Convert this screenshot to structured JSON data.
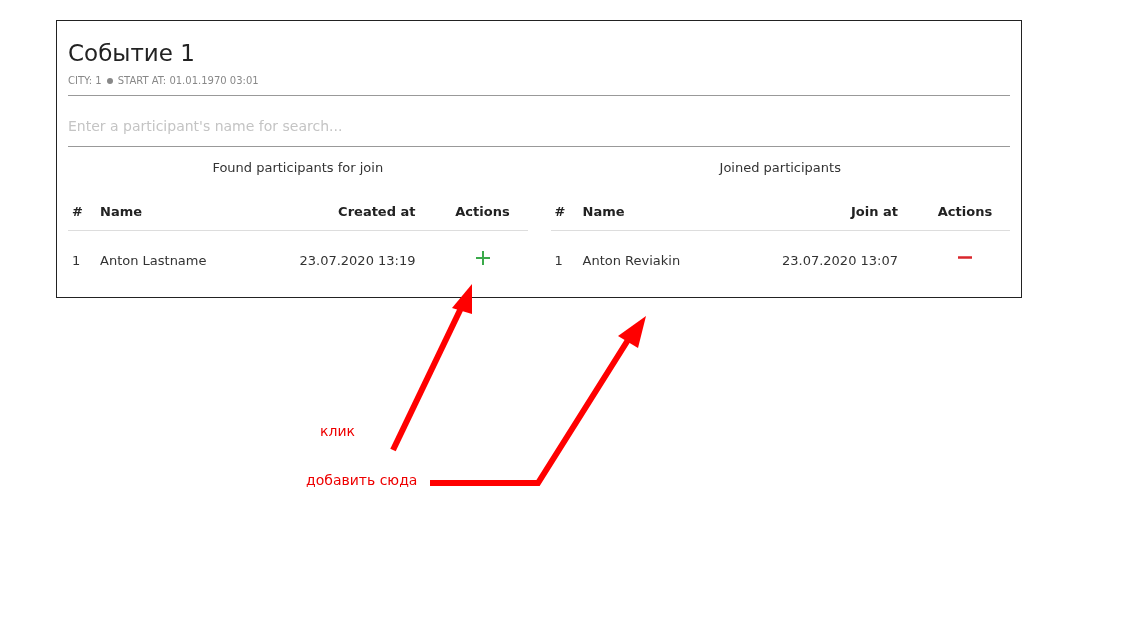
{
  "event": {
    "title": "Событие 1",
    "meta": [
      "CITY: 1",
      "START AT: 01.01.1970 03:01"
    ]
  },
  "search": {
    "placeholder": "Enter a participant's name for search..."
  },
  "tables": [
    {
      "title": "Found participants for join",
      "columns": [
        "#",
        "Name",
        "Created at",
        "Actions"
      ],
      "rows": [
        {
          "cells": [
            "1",
            "Anton Lastname",
            "23.07.2020 13:19"
          ],
          "kind": "add"
        }
      ]
    },
    {
      "title": "Joined participants",
      "columns": [
        "#",
        "Name",
        "Join at",
        "Actions"
      ],
      "rows": [
        {
          "cells": [
            "1",
            "Anton Reviakin",
            "23.07.2020 13:07"
          ],
          "kind": "remove"
        }
      ]
    }
  ],
  "annotations": [
    {
      "kind": "click",
      "text": "клик"
    },
    {
      "kind": "add_here",
      "text": "добавить сюда"
    }
  ]
}
